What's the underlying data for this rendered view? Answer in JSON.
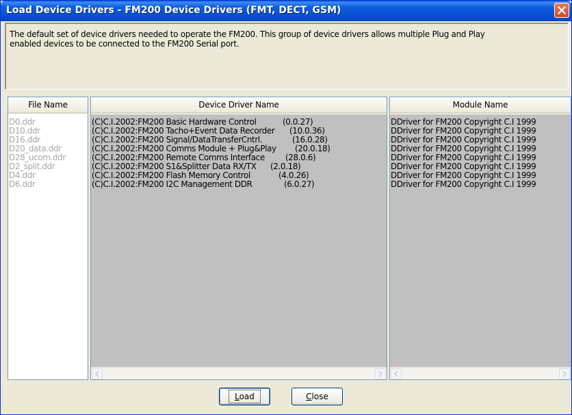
{
  "window": {
    "title": "Load Device Drivers - FM200 Device Drivers (FMT, DECT, GSM)"
  },
  "description": {
    "line1": "The default set of device drivers needed to operate the FM200. This group of device drivers allows multiple Plug and Play",
    "line2": "enabled devices to be connected to the FM200 Serial port."
  },
  "columns": {
    "file_name": "File Name",
    "driver_name": "Device Driver Name",
    "module_name": "Module Name"
  },
  "files": [
    "D0.ddr",
    "D10.ddr",
    "D16.ddr",
    "D20_data.ddr",
    "D28_ucom.ddr",
    "D2_split.ddr",
    "D4.ddr",
    "D6.ddr"
  ],
  "drivers": [
    {
      "name": "(C)C.I.2002:FM200 Basic Hardware Control",
      "version": "(0.0.27)",
      "module": "DDriver for FM200 Copyright C.I 1999"
    },
    {
      "name": "(C)C.I.2002:FM200 Tacho+Event Data Recorder",
      "version": "(10.0.36)",
      "module": "DDriver for FM200 Copyright C.I 1999"
    },
    {
      "name": "(C)C.I.2002:FM200 Signal/DataTransferCntrl.",
      "version": "(16.0.28)",
      "module": "DDriver for FM200 Copyright C.I 1999"
    },
    {
      "name": "(C)C.I.2002:FM200 Comms Module + Plug&Play",
      "version": "(20.0.18)",
      "module": "DDriver for FM200 Copyright C.I 1999"
    },
    {
      "name": "(C)C.I.2002:FM200 Remote Comms Interface",
      "version": "(28.0.6)",
      "module": "DDriver for FM200 Copyright C.I 1999"
    },
    {
      "name": "(C)C.I.2002:FM200 S1&Splitter Data RX/TX",
      "version": "(2.0.18)",
      "module": "DDriver for FM200 Copyright C.I 1999"
    },
    {
      "name": "(C)C.I.2002:FM200 Flash Memory Control",
      "version": "(4.0.26)",
      "module": "DDriver for FM200 Copyright C.I 1999"
    },
    {
      "name": "(C)C.I.2002:FM200 I2C Management DDR",
      "version": "(6.0.27)",
      "module": "DDriver for FM200 Copyright C.I 1999"
    }
  ],
  "buttons": {
    "load": "Load",
    "close": "Close"
  },
  "icons": {
    "close": "close-icon",
    "scroll_left": "arrow-left-icon",
    "scroll_right": "arrow-right-icon"
  },
  "colors": {
    "title_bar": "#0a4fd2",
    "close_button": "#d14a27",
    "selection_bg": "#c0c0c0",
    "file_text": "#a6a6a6"
  }
}
